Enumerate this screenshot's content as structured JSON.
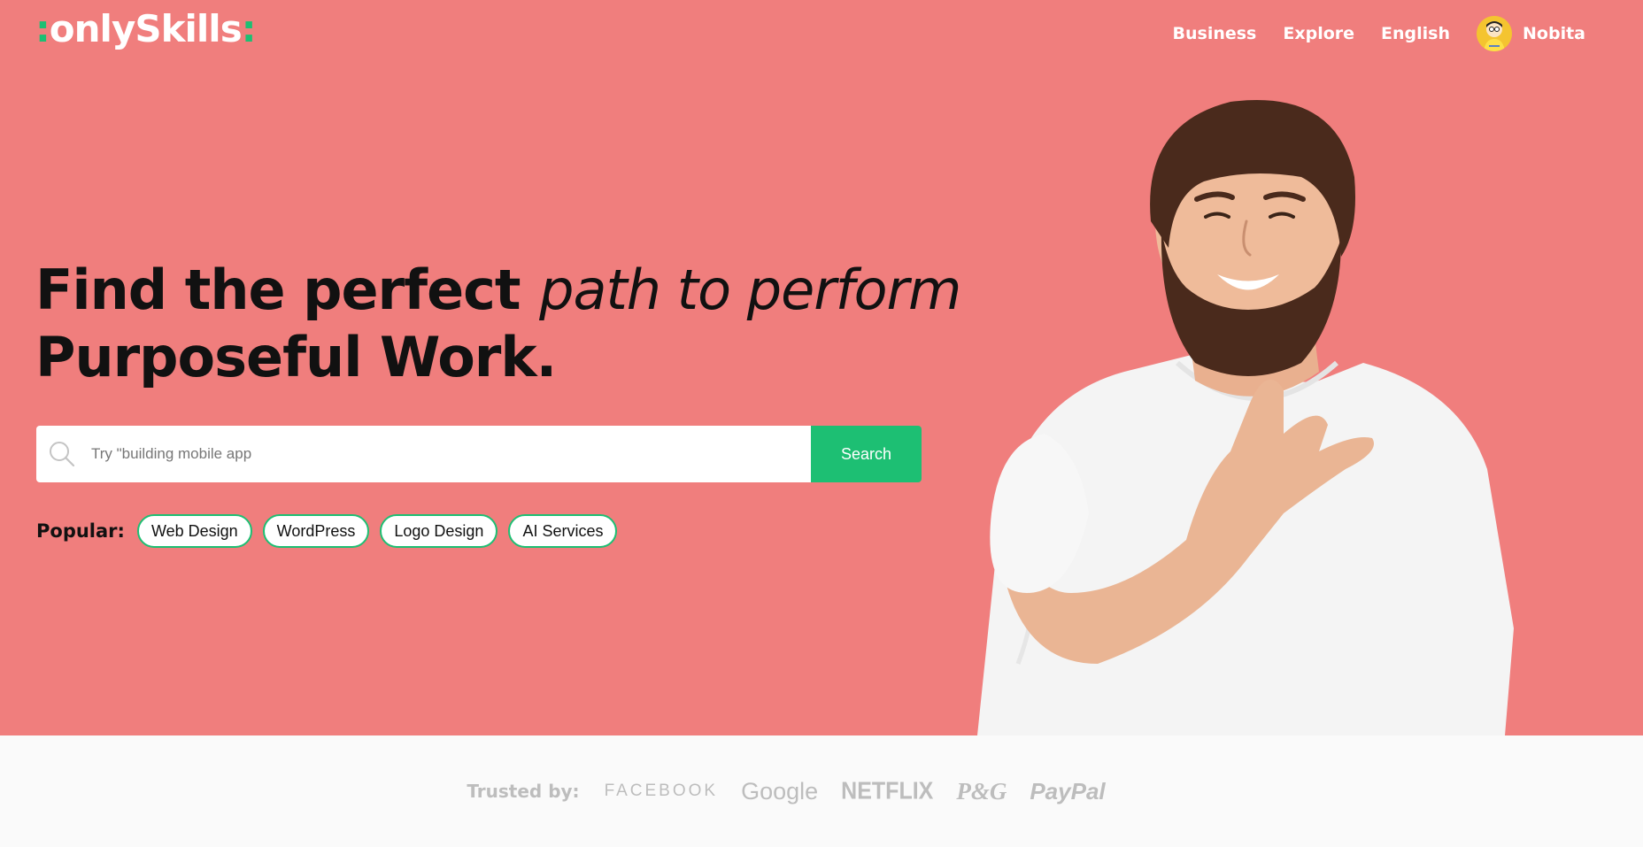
{
  "brand": {
    "name": "onlySkills",
    "prefix_dot": ":",
    "suffix_dot": ":",
    "accent_color": "#1dbf73"
  },
  "nav": {
    "links": [
      {
        "label": "Business"
      },
      {
        "label": "Explore"
      },
      {
        "label": "English"
      }
    ],
    "user": {
      "name": "Nobita"
    }
  },
  "hero": {
    "background_color": "#f07e7d",
    "headline_bold": "Find the perfect",
    "headline_italic": "path to perform",
    "headline_line2": "Purposeful Work.",
    "search": {
      "placeholder": "Try \"building mobile app",
      "button_label": "Search",
      "icon": "search-icon"
    },
    "popular": {
      "label": "Popular:",
      "tags": [
        "Web Design",
        "WordPress",
        "Logo Design",
        "AI Services"
      ]
    }
  },
  "trusted": {
    "label": "Trusted by:",
    "brands": [
      "FACEBOOK",
      "Google",
      "NETFLIX",
      "P&G",
      "PayPal"
    ]
  }
}
